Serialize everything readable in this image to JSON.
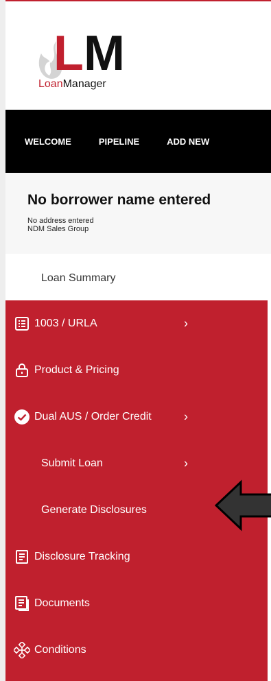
{
  "logo": {
    "initial_l": "L",
    "initial_m": "M",
    "name_part1": "Loan",
    "name_part2": "Manager"
  },
  "nav": {
    "items": [
      "WELCOME",
      "PIPELINE",
      "ADD NEW"
    ]
  },
  "borrower": {
    "name": "No borrower name entered",
    "address": "No address entered",
    "group": "NDM Sales Group"
  },
  "summary": {
    "label": "Loan Summary"
  },
  "menu": {
    "items": [
      {
        "label": "1003 / URLA",
        "icon": "list-icon",
        "chevron": "›"
      },
      {
        "label": "Product & Pricing",
        "icon": "lock-icon"
      },
      {
        "label": "Dual AUS / Order Credit",
        "icon": "check-circle-icon",
        "chevron": "›"
      },
      {
        "label": "Submit Loan",
        "chevron": "›"
      },
      {
        "label": "Generate Disclosures"
      },
      {
        "label": "Disclosure Tracking",
        "icon": "document-icon"
      },
      {
        "label": "Documents",
        "icon": "documents-icon"
      },
      {
        "label": "Conditions",
        "icon": "network-icon"
      }
    ]
  },
  "colors": {
    "brand_red": "#c0202e",
    "nav_black": "#000000"
  }
}
